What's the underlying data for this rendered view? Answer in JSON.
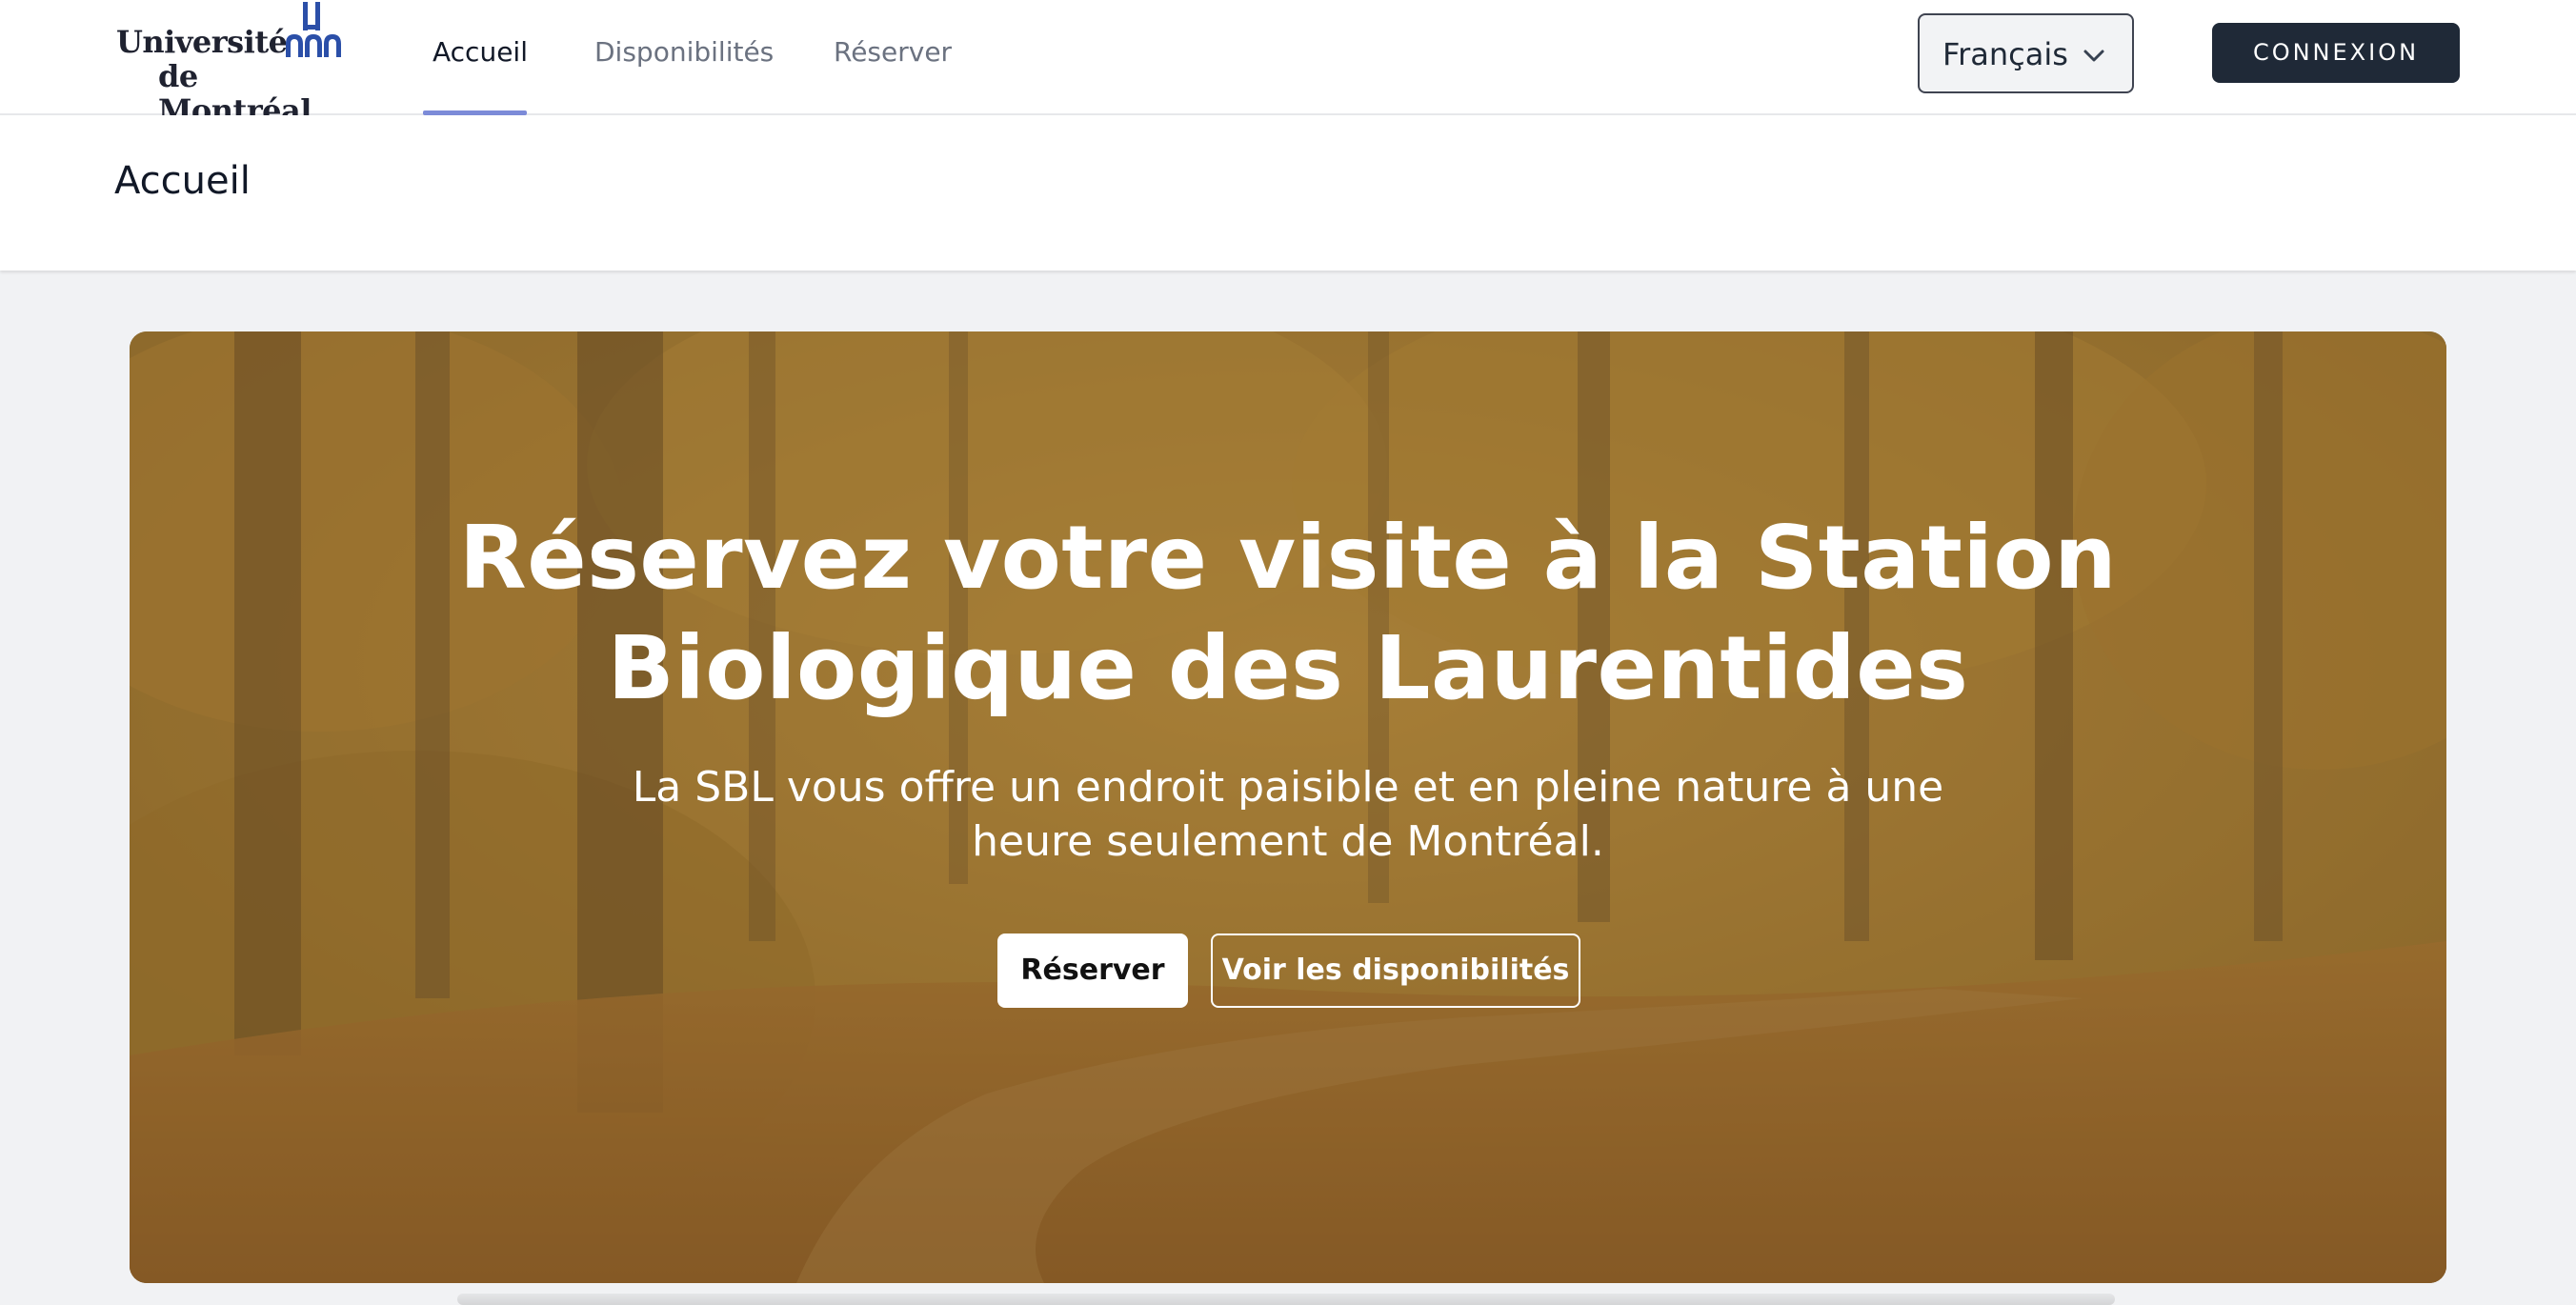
{
  "logo": {
    "line1": "Université",
    "line2": "de Montréal",
    "brand_color": "#2b4fa8"
  },
  "nav": {
    "items": [
      {
        "label": "Accueil",
        "active": true
      },
      {
        "label": "Disponibilités",
        "active": false
      },
      {
        "label": "Réserver",
        "active": false
      }
    ],
    "active_color": "#7c8bd8"
  },
  "language": {
    "selected": "Français",
    "icon": "chevron-down-icon"
  },
  "login": {
    "label": "CONNEXION",
    "color": "#1f2937"
  },
  "page": {
    "title": "Accueil"
  },
  "hero": {
    "title": "Réservez votre visite à la Station Biologique des Laurentides",
    "subtitle": "La SBL vous offre un endroit paisible et en pleine nature à une heure seulement de Montréal.",
    "primary_button": "Réserver",
    "secondary_button": "Voir les disponibilités",
    "background": "autumn forest path"
  }
}
